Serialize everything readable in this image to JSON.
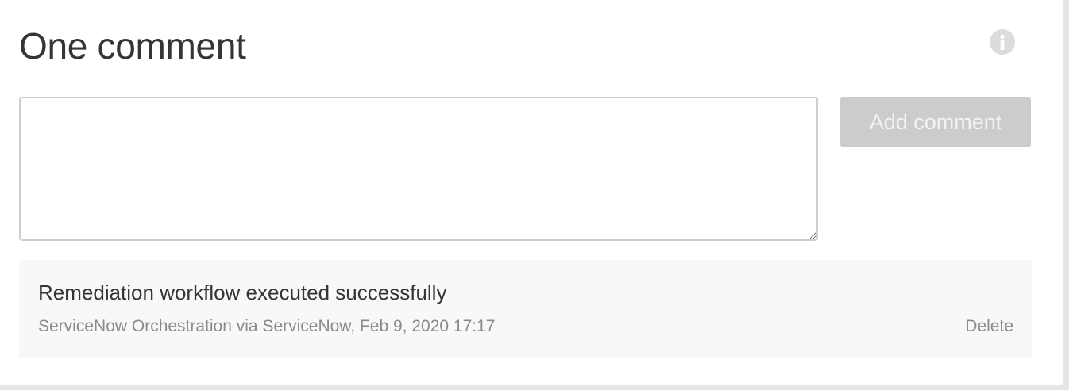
{
  "comments_section": {
    "title": "One comment",
    "info_icon": "info-icon",
    "input": {
      "value": "",
      "placeholder": ""
    },
    "add_button_label": "Add comment",
    "add_button_enabled": false
  },
  "comments": [
    {
      "text": "Remediation workflow executed successfully",
      "author_source": "ServiceNow Orchestration via ServiceNow",
      "timestamp": "Feb 9, 2020 17:17",
      "meta": "ServiceNow Orchestration via ServiceNow, Feb 9, 2020 17:17",
      "delete_label": "Delete"
    }
  ],
  "colors": {
    "title_text": "#353535",
    "muted_text": "#8a8a8a",
    "button_disabled_bg": "#cccccc",
    "button_disabled_text": "#f3f3f3",
    "comment_bg": "#f8f8f8",
    "input_border": "#cfcfcf",
    "page_bg": "#e6e6e6",
    "info_icon_bg": "#dcdcdc"
  }
}
